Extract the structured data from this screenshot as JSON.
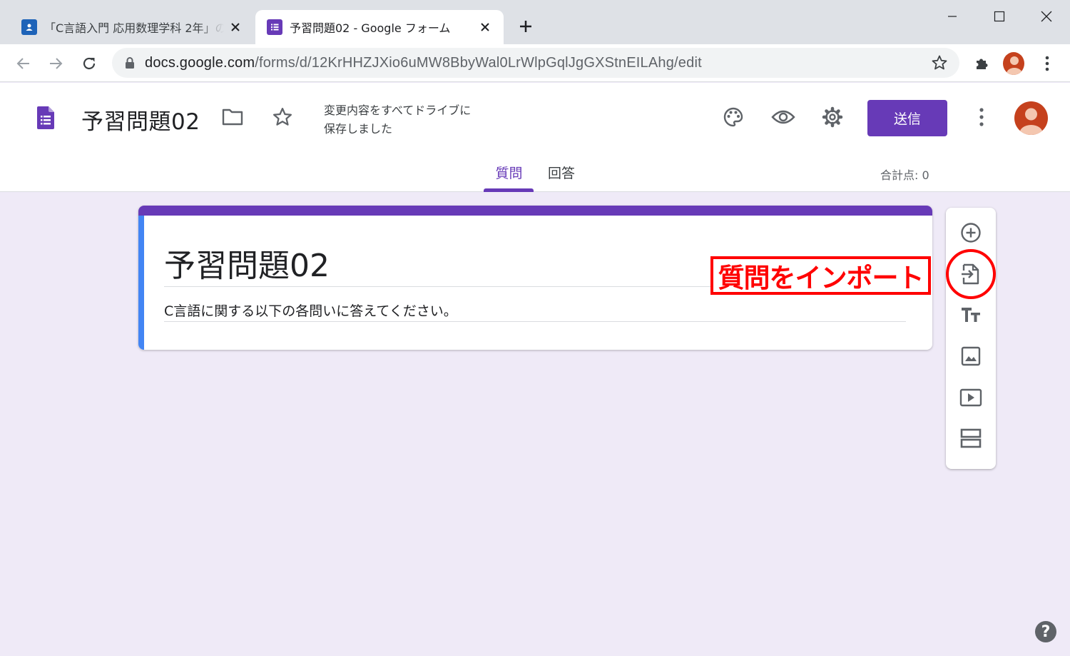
{
  "browser": {
    "tabs": [
      {
        "title": "「C言語入門 応用数理学科 2年」の",
        "active": false,
        "favicon": "google-classroom-icon"
      },
      {
        "title": "予習問題02 - Google フォーム",
        "active": true,
        "favicon": "google-forms-icon"
      }
    ],
    "url_host": "docs.google.com",
    "url_path": "/forms/d/12KrHHZJXio6uMW8BbyWal0LrWlpGqlJgGXStnEILAhg/edit"
  },
  "header": {
    "title": "予習問題02",
    "save_status_line1": "変更内容をすべてドライブに",
    "save_status_line2": "保存しました",
    "send_label": "送信"
  },
  "tabs": {
    "questions": "質問",
    "responses": "回答",
    "total_points": "合計点: 0"
  },
  "form": {
    "title": "予習問題02",
    "description": "C言語に関する以下の各問いに答えてください。"
  },
  "side_toolbar": {
    "items": [
      "add-question-icon",
      "import-questions-icon",
      "add-title-icon",
      "add-image-icon",
      "add-video-icon",
      "add-section-icon"
    ]
  },
  "annotation": {
    "label": "質問をインポート",
    "color": "#ff0000"
  },
  "help": "?",
  "colors": {
    "accent": "#673ab7",
    "card_left_bar": "#4285f4",
    "background": "#efeaf7"
  }
}
